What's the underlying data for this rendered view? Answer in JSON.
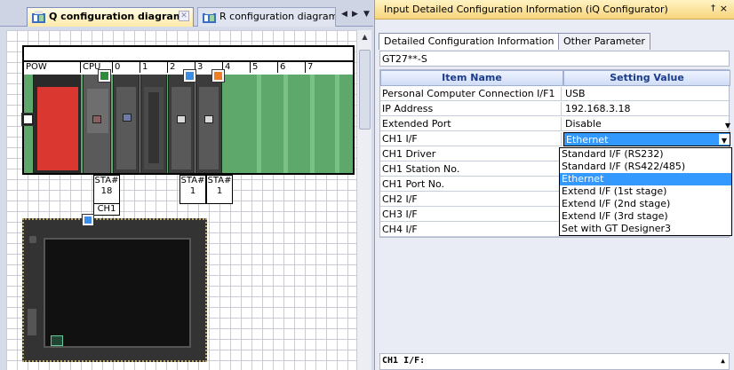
{
  "left_tabs": [
    {
      "label": "Q configuration diagram",
      "active": true
    },
    {
      "label": "R configuration diagram",
      "active": false
    }
  ],
  "rack": {
    "slots": [
      "POW",
      "CPU",
      "0",
      "1",
      "2",
      "3",
      "4",
      "5",
      "6",
      "7"
    ],
    "station_labels": [
      {
        "line1": "STA#",
        "line2": "18",
        "line3": "CH1"
      },
      {
        "line1": "STA#",
        "line2": "1"
      },
      {
        "line1": "STA#",
        "line2": "1"
      }
    ]
  },
  "right_panel": {
    "title": "Input Detailed Configuration Information (iQ Configurator)",
    "pin": "†",
    "close": "×",
    "tabs": [
      "Detailed Configuration Information",
      "Other Parameter"
    ],
    "model": "GT27**-S",
    "headers": {
      "item": "Item Name",
      "value": "Setting Value"
    },
    "rows": [
      {
        "item": "Personal Computer Connection I/F1",
        "value": "USB",
        "dropdown": false
      },
      {
        "item": "IP Address",
        "value": "192.168.3.18",
        "dropdown": false
      },
      {
        "item": "Extended Port",
        "value": "Disable",
        "dropdown": true
      },
      {
        "item": "CH1 I/F",
        "value": "Ethernet",
        "dropdown": true,
        "selected": true
      },
      {
        "item": "CH1 Driver",
        "value": "",
        "dropdown": false
      },
      {
        "item": "CH1 Station No.",
        "value": "",
        "dropdown": false
      },
      {
        "item": "CH1 Port No.",
        "value": "",
        "dropdown": false
      },
      {
        "item": "CH2 I/F",
        "value": "",
        "dropdown": false
      },
      {
        "item": "CH3 I/F",
        "value": "",
        "dropdown": false
      },
      {
        "item": "CH4 I/F",
        "value": "",
        "dropdown": false
      }
    ],
    "dropdown_options": [
      {
        "label": "Standard I/F (RS232)",
        "highlighted": false
      },
      {
        "label": "Standard I/F (RS422/485)",
        "highlighted": false
      },
      {
        "label": "Ethernet",
        "highlighted": true
      },
      {
        "label": "Extend I/F (1st stage)",
        "highlighted": false
      },
      {
        "label": "Extend I/F (2nd stage)",
        "highlighted": false
      },
      {
        "label": "Extend I/F (3rd stage)",
        "highlighted": false
      },
      {
        "label": "Set with GT Designer3",
        "highlighted": false
      }
    ],
    "status_label": "CH1 I/F:"
  },
  "colors": {
    "accent_blue": "#3399ff",
    "rack_green": "#5da86a",
    "power_red": "#d9372f",
    "marker_orange": "#f07d23",
    "marker_blue": "#3a8ee6"
  }
}
